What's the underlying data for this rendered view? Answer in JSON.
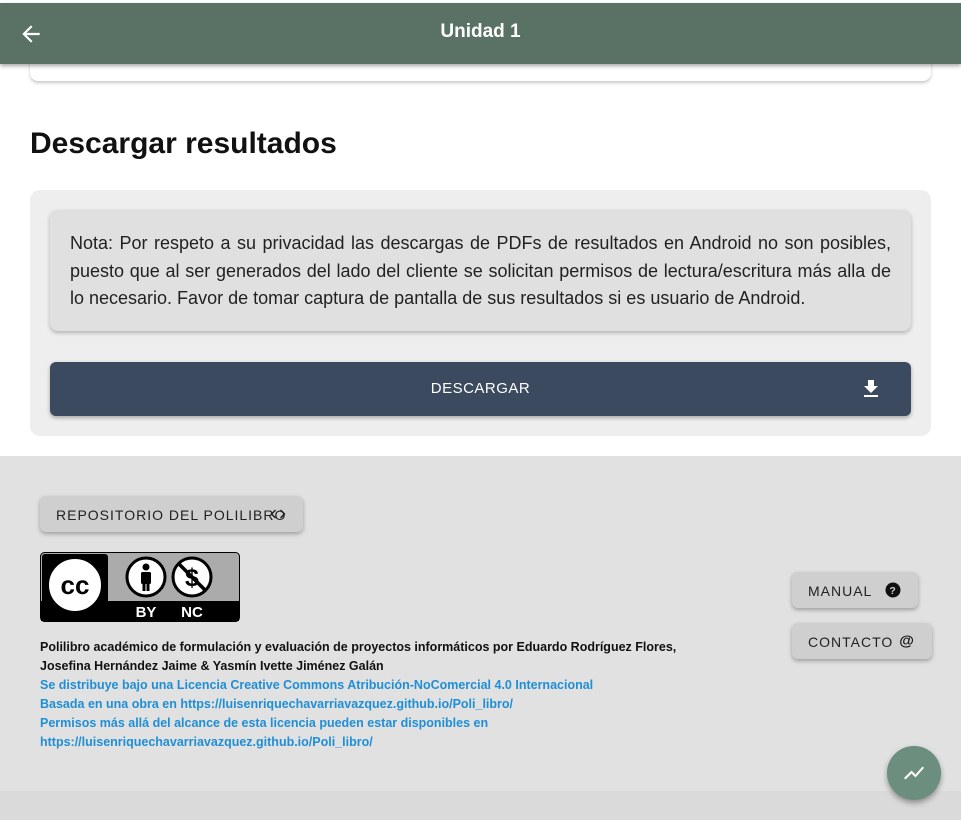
{
  "header": {
    "title": "Unidad 1",
    "back_icon": "arrow-left-icon"
  },
  "section": {
    "title": "Descargar resultados"
  },
  "note": {
    "text": "Nota: Por respeto a su privacidad las descargas de PDFs de resultados en Android no son posibles, puesto que al ser generados del lado del cliente se solicitan permisos de lectura/escritura más alla de lo necesario. Favor de tomar captura de pantalla de sus resultados si es usuario de Android."
  },
  "download": {
    "label": "DESCARGAR",
    "icon": "download-icon"
  },
  "footer": {
    "repo_button": "REPOSITORIO DEL POLILIBRO",
    "repo_icon": "code-icon",
    "license_badge": {
      "cc": "cc",
      "by": "BY",
      "nc": "NC"
    },
    "authors": "Polilibro académico de formulación y evaluación de proyectos informáticos por Eduardo Rodríguez Flores, Josefina Hernández Jaime & Yasmín Ivette Jiménez Galán",
    "license_link": "Se distribuye bajo una Licencia Creative Commons Atribución-NoComercial 4.0 Internacional",
    "based_on": "Basada en una obra en https://luisenriquechavarriavazquez.github.io/Poli_libro/",
    "permissions": "Permisos más allá del alcance de esta licencia pueden estar disponibles en https://luisenriquechavarriavazquez.github.io/Poli_libro/",
    "manual_button": "MANUAL",
    "manual_icon": "help-circle-icon",
    "contact_button": "CONTACTO",
    "contact_icon": "at-sign-icon"
  },
  "fab": {
    "icon": "trending-up-icon"
  },
  "colors": {
    "appbar": "#5a7265",
    "download_button": "#3b4a5f",
    "link": "#1e8fd6",
    "fab": "#6b8e7e"
  }
}
